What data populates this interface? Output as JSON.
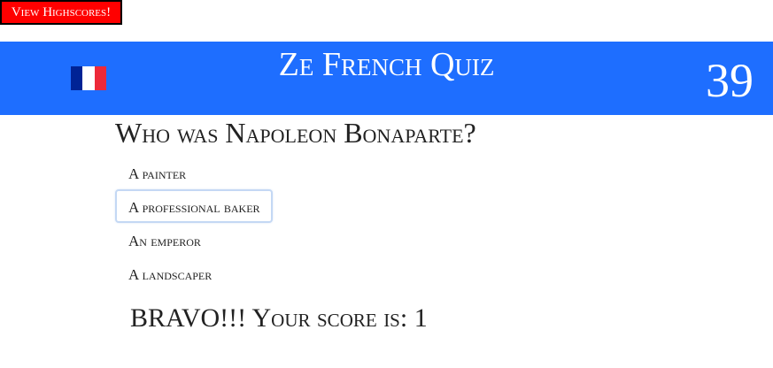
{
  "highscores_button": {
    "label": "View Highscores!",
    "color": "#ff0000"
  },
  "header": {
    "title": "Ze French Quiz",
    "timer": "39",
    "background": "#1e6eff",
    "flag_icon": "france-flag-icon",
    "flag_colors": [
      "#002395",
      "#ffffff",
      "#ed2939"
    ]
  },
  "question": {
    "text": "Who was Napoleon Bonaparte?"
  },
  "answers": [
    {
      "label": "A painter"
    },
    {
      "label": "A professional baker",
      "focused": true
    },
    {
      "label": "An emperor"
    },
    {
      "label": "A landscaper"
    }
  ],
  "result": {
    "text": "BRAVO!!! Your score is: 1"
  }
}
